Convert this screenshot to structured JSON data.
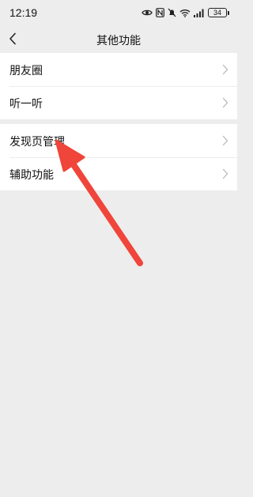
{
  "status_bar": {
    "time": "12:19",
    "battery": "34",
    "icons": [
      "eye-icon",
      "nfc-icon",
      "silent-icon",
      "wifi-icon",
      "signal-icon",
      "battery-icon"
    ]
  },
  "nav": {
    "title": "其他功能",
    "back_icon": "chevron-left-icon"
  },
  "groups": [
    {
      "items": [
        {
          "label": "朋友圈"
        },
        {
          "label": "听一听"
        }
      ]
    },
    {
      "items": [
        {
          "label": "发现页管理"
        },
        {
          "label": "辅助功能"
        }
      ]
    }
  ],
  "colors": {
    "background": "#ededed",
    "cell_background": "#ffffff",
    "annotation_arrow": "#f0453a"
  }
}
